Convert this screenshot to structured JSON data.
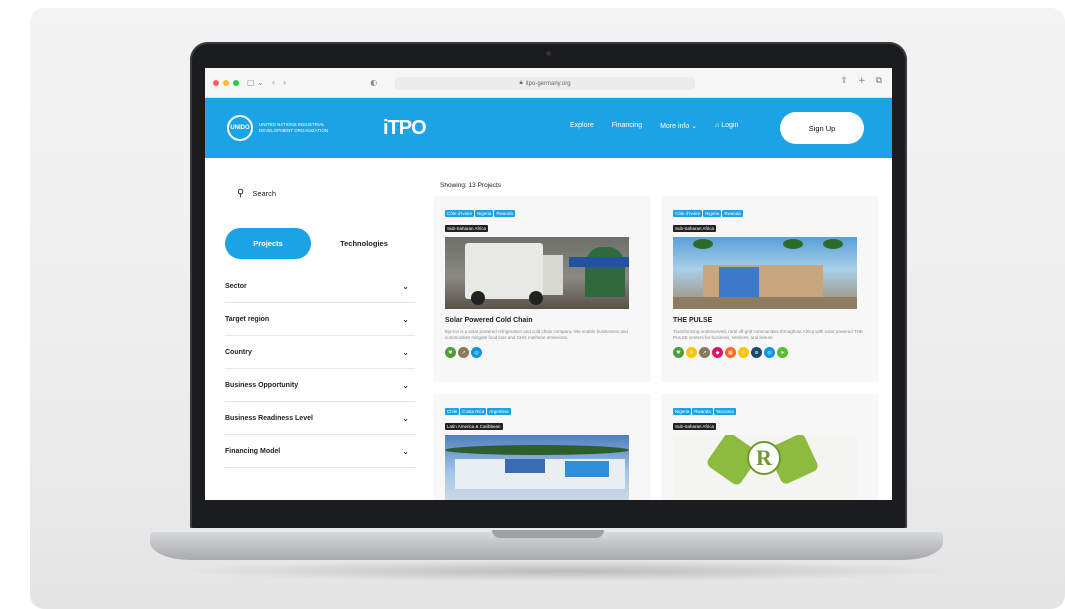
{
  "browser": {
    "url": "itpo-germany.org",
    "traffic_lights": [
      "#ff5f57",
      "#febc2e",
      "#28c840"
    ]
  },
  "header": {
    "unido_logo_text": "UNIDO",
    "unido_name": "UNITED NATIONS INDUSTRIAL DEVELOPMENT ORGANIZATION",
    "itpo_logo": "iTPO",
    "nav": [
      "Explore",
      "Financing",
      "More info ⌄",
      "⌂ Login"
    ],
    "signup": "Sign Up",
    "accent": "#1ca3e6"
  },
  "sidebar": {
    "search_label": "Search",
    "tabs": {
      "projects": "Projects",
      "technologies": "Technologies"
    },
    "filters": [
      "Sector",
      "Target region",
      "Country",
      "Business Opportunity",
      "Business Readiness Level",
      "Financing Model"
    ]
  },
  "main": {
    "showing": "Showing: 13 Projects",
    "cards": [
      {
        "tags": [
          "Côte d'Ivoire",
          "Nigeria",
          "Rwanda"
        ],
        "region": "Sub-Saharan Africa",
        "title": "Solar Powered Cold Chain",
        "desc": "Eja-Ice is a solar powered refrigeration and cold chain company. We enable businesses and communities mitigate food loss and GHG methane emissions.",
        "sdg_colors": [
          "#4c9f38",
          "#a21942",
          "#0a97d9"
        ]
      },
      {
        "tags": [
          "Côte d'Ivoire",
          "Nigeria",
          "Rwanda"
        ],
        "region": "Sub-Saharan Africa",
        "title": "THE PULSE",
        "desc": "Transforming underserved, rural off-grid communities throughout Africa with solar powered THE PULSE centers for business, services, and leisure",
        "sdg_colors": [
          "#4c9f38",
          "#fcc30b",
          "#a21942",
          "#dd1367",
          "#fd6925",
          "#fcc30b",
          "#19486a",
          "#0a97d9",
          "#56c02b"
        ]
      },
      {
        "tags": [
          "Chile",
          "Costa Rica",
          "Argentina"
        ],
        "region": "Latin America & Caribbean",
        "title": "",
        "desc": "",
        "sdg_colors": []
      },
      {
        "tags": [
          "Nigeria",
          "Rwanda",
          "Tanzania"
        ],
        "region": "Sub-Saharan Africa",
        "title": "",
        "desc": "",
        "sdg_colors": []
      }
    ]
  }
}
